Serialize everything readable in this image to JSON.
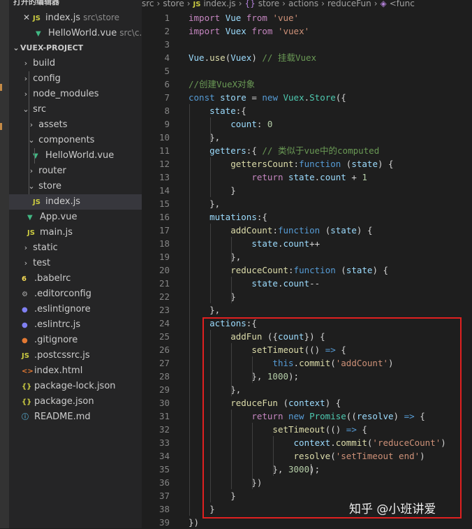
{
  "breadcrumb": {
    "segments": [
      "src",
      "store",
      "index.js",
      "store",
      "actions",
      "reduceFun",
      "<func"
    ],
    "separator": "›"
  },
  "sidebar": {
    "open_editors_title": "打开的编辑器",
    "open_editors": [
      {
        "name": "index.js",
        "desc": "src\\store",
        "icon": "js-file-icon",
        "close": "✕"
      },
      {
        "name": "HelloWorld.vue",
        "desc": "src\\c...",
        "icon": "vue-file-icon"
      }
    ],
    "project_title": "VUEX-PROJECT",
    "tree": [
      {
        "label": "build",
        "kind": "folder",
        "open": false,
        "depth": 0
      },
      {
        "label": "config",
        "kind": "folder",
        "open": false,
        "depth": 0
      },
      {
        "label": "node_modules",
        "kind": "folder",
        "open": false,
        "depth": 0
      },
      {
        "label": "src",
        "kind": "folder",
        "open": true,
        "depth": 0
      },
      {
        "label": "assets",
        "kind": "folder",
        "open": false,
        "depth": 1
      },
      {
        "label": "components",
        "kind": "folder",
        "open": true,
        "depth": 1
      },
      {
        "label": "HelloWorld.vue",
        "kind": "vue",
        "depth": 2
      },
      {
        "label": "router",
        "kind": "folder",
        "open": false,
        "depth": 1
      },
      {
        "label": "store",
        "kind": "folder",
        "open": true,
        "depth": 1
      },
      {
        "label": "index.js",
        "kind": "js",
        "depth": 2,
        "selected": true
      },
      {
        "label": "App.vue",
        "kind": "vue",
        "depth": 1
      },
      {
        "label": "main.js",
        "kind": "js",
        "depth": 1
      },
      {
        "label": "static",
        "kind": "folder",
        "open": false,
        "depth": 0
      },
      {
        "label": "test",
        "kind": "folder",
        "open": false,
        "depth": 0
      },
      {
        "label": ".babelrc",
        "kind": "babel",
        "depth": 0
      },
      {
        "label": ".editorconfig",
        "kind": "gear",
        "depth": 0
      },
      {
        "label": ".eslintignore",
        "kind": "eslint",
        "depth": 0
      },
      {
        "label": ".eslintrc.js",
        "kind": "eslint",
        "depth": 0
      },
      {
        "label": ".gitignore",
        "kind": "git",
        "depth": 0
      },
      {
        "label": ".postcssrc.js",
        "kind": "js",
        "depth": 0
      },
      {
        "label": "index.html",
        "kind": "html",
        "depth": 0
      },
      {
        "label": "package-lock.json",
        "kind": "json",
        "depth": 0
      },
      {
        "label": "package.json",
        "kind": "json",
        "depth": 0
      },
      {
        "label": "README.md",
        "kind": "info",
        "depth": 0
      }
    ],
    "icons": {
      "js": {
        "glyph": "JS",
        "color": "#cbcb41"
      },
      "vue": {
        "glyph": "▼",
        "color": "#41b883"
      },
      "babel": {
        "glyph": "6",
        "color": "#f5da55"
      },
      "gear": {
        "glyph": "⚙",
        "color": "#aaaaaa"
      },
      "eslint": {
        "glyph": "●",
        "color": "#8080f2"
      },
      "git": {
        "glyph": "●",
        "color": "#e37933"
      },
      "html": {
        "glyph": "<>",
        "color": "#e37933"
      },
      "json": {
        "glyph": "{}",
        "color": "#cbcb41"
      },
      "info": {
        "glyph": "ⓘ",
        "color": "#519aba"
      }
    }
  },
  "editor": {
    "lines": [
      [
        [
          "k",
          "import"
        ],
        [
          "p",
          " "
        ],
        [
          "v",
          "Vue"
        ],
        [
          "p",
          " "
        ],
        [
          "k",
          "from"
        ],
        [
          "p",
          " "
        ],
        [
          "s",
          "'vue'"
        ]
      ],
      [
        [
          "k",
          "import"
        ],
        [
          "p",
          " "
        ],
        [
          "v",
          "Vuex"
        ],
        [
          "p",
          " "
        ],
        [
          "k",
          "from"
        ],
        [
          "p",
          " "
        ],
        [
          "s",
          "'vuex'"
        ]
      ],
      [],
      [
        [
          "v",
          "Vue"
        ],
        [
          "p",
          "."
        ],
        [
          "f",
          "use"
        ],
        [
          "p",
          "("
        ],
        [
          "v",
          "Vuex"
        ],
        [
          "p",
          ") "
        ],
        [
          "c",
          "// 挂载Vuex"
        ]
      ],
      [],
      [
        [
          "c",
          "//创建VueX对象"
        ]
      ],
      [
        [
          "b",
          "const"
        ],
        [
          "p",
          " "
        ],
        [
          "v",
          "store"
        ],
        [
          "p",
          " = "
        ],
        [
          "b",
          "new"
        ],
        [
          "p",
          " "
        ],
        [
          "t",
          "Vuex"
        ],
        [
          "p",
          "."
        ],
        [
          "t",
          "Store"
        ],
        [
          "p",
          "({"
        ]
      ],
      [
        [
          "p",
          "    "
        ],
        [
          "v",
          "state"
        ],
        [
          "p",
          ":{"
        ]
      ],
      [
        [
          "p",
          "        "
        ],
        [
          "v",
          "count"
        ],
        [
          "p",
          ": "
        ],
        [
          "n",
          "0"
        ]
      ],
      [
        [
          "p",
          "    },"
        ]
      ],
      [
        [
          "p",
          "    "
        ],
        [
          "v",
          "getters"
        ],
        [
          "p",
          ":{ "
        ],
        [
          "c",
          "// 类似于vue中的computed"
        ]
      ],
      [
        [
          "p",
          "        "
        ],
        [
          "f",
          "gettersCount"
        ],
        [
          "p",
          ":"
        ],
        [
          "b",
          "function"
        ],
        [
          "p",
          " ("
        ],
        [
          "v",
          "state"
        ],
        [
          "p",
          ") {"
        ]
      ],
      [
        [
          "p",
          "            "
        ],
        [
          "k",
          "return"
        ],
        [
          "p",
          " "
        ],
        [
          "v",
          "state"
        ],
        [
          "p",
          "."
        ],
        [
          "v",
          "count"
        ],
        [
          "p",
          " + "
        ],
        [
          "n",
          "1"
        ]
      ],
      [
        [
          "p",
          "        }"
        ]
      ],
      [
        [
          "p",
          "    },"
        ]
      ],
      [
        [
          "p",
          "    "
        ],
        [
          "v",
          "mutations"
        ],
        [
          "p",
          ":{"
        ]
      ],
      [
        [
          "p",
          "        "
        ],
        [
          "f",
          "addCount"
        ],
        [
          "p",
          ":"
        ],
        [
          "b",
          "function"
        ],
        [
          "p",
          " ("
        ],
        [
          "v",
          "state"
        ],
        [
          "p",
          ") {"
        ]
      ],
      [
        [
          "p",
          "            "
        ],
        [
          "v",
          "state"
        ],
        [
          "p",
          "."
        ],
        [
          "v",
          "count"
        ],
        [
          "p",
          "++"
        ]
      ],
      [
        [
          "p",
          "        },"
        ]
      ],
      [
        [
          "p",
          "        "
        ],
        [
          "f",
          "reduceCount"
        ],
        [
          "p",
          ":"
        ],
        [
          "b",
          "function"
        ],
        [
          "p",
          " ("
        ],
        [
          "v",
          "state"
        ],
        [
          "p",
          ") {"
        ]
      ],
      [
        [
          "p",
          "            "
        ],
        [
          "v",
          "state"
        ],
        [
          "p",
          "."
        ],
        [
          "v",
          "count"
        ],
        [
          "p",
          "--"
        ]
      ],
      [
        [
          "p",
          "        }"
        ]
      ],
      [
        [
          "p",
          "    },"
        ]
      ],
      [
        [
          "p",
          "    "
        ],
        [
          "v",
          "actions"
        ],
        [
          "p",
          ":{"
        ]
      ],
      [
        [
          "p",
          "        "
        ],
        [
          "f",
          "addFun"
        ],
        [
          "p",
          " ({"
        ],
        [
          "v",
          "count"
        ],
        [
          "p",
          "}) {"
        ]
      ],
      [
        [
          "p",
          "            "
        ],
        [
          "f",
          "setTimeout"
        ],
        [
          "p",
          "(() "
        ],
        [
          "b",
          "=>"
        ],
        [
          "p",
          " {"
        ]
      ],
      [
        [
          "p",
          "                "
        ],
        [
          "b",
          "this"
        ],
        [
          "p",
          "."
        ],
        [
          "f",
          "commit"
        ],
        [
          "p",
          "("
        ],
        [
          "s",
          "'addCount'"
        ],
        [
          "p",
          ")"
        ]
      ],
      [
        [
          "p",
          "            }, "
        ],
        [
          "n",
          "1000"
        ],
        [
          "p",
          ");"
        ]
      ],
      [
        [
          "p",
          "        },"
        ]
      ],
      [
        [
          "p",
          "        "
        ],
        [
          "f",
          "reduceFun"
        ],
        [
          "p",
          " ("
        ],
        [
          "v",
          "context"
        ],
        [
          "p",
          ") {"
        ]
      ],
      [
        [
          "p",
          "            "
        ],
        [
          "k",
          "return"
        ],
        [
          "p",
          " "
        ],
        [
          "b",
          "new"
        ],
        [
          "p",
          " "
        ],
        [
          "t",
          "Promise"
        ],
        [
          "p",
          "(("
        ],
        [
          "v",
          "resolve"
        ],
        [
          "p",
          ") "
        ],
        [
          "b",
          "=>"
        ],
        [
          "p",
          " {"
        ]
      ],
      [
        [
          "p",
          "                "
        ],
        [
          "f",
          "setTimeout"
        ],
        [
          "p",
          "(() "
        ],
        [
          "b",
          "=>"
        ],
        [
          "p",
          " {"
        ]
      ],
      [
        [
          "p",
          "                    "
        ],
        [
          "v",
          "context"
        ],
        [
          "p",
          "."
        ],
        [
          "f",
          "commit"
        ],
        [
          "p",
          "("
        ],
        [
          "s",
          "'reduceCount'"
        ],
        [
          "p",
          ")"
        ]
      ],
      [
        [
          "p",
          "                    "
        ],
        [
          "f",
          "resolve"
        ],
        [
          "p",
          "("
        ],
        [
          "s",
          "'setTimeout end'"
        ],
        [
          "p",
          ")"
        ]
      ],
      [
        [
          "p",
          "                }, "
        ],
        [
          "n",
          "3000"
        ],
        [
          "p",
          ");"
        ]
      ],
      [
        [
          "p",
          "            })"
        ]
      ],
      [
        [
          "p",
          "        }"
        ]
      ],
      [
        [
          "p",
          "    }"
        ]
      ],
      [
        [
          "p",
          "})"
        ]
      ]
    ]
  },
  "watermark": "知乎 @小班讲爱",
  "colors": {
    "highlight_box": "#e02020"
  }
}
